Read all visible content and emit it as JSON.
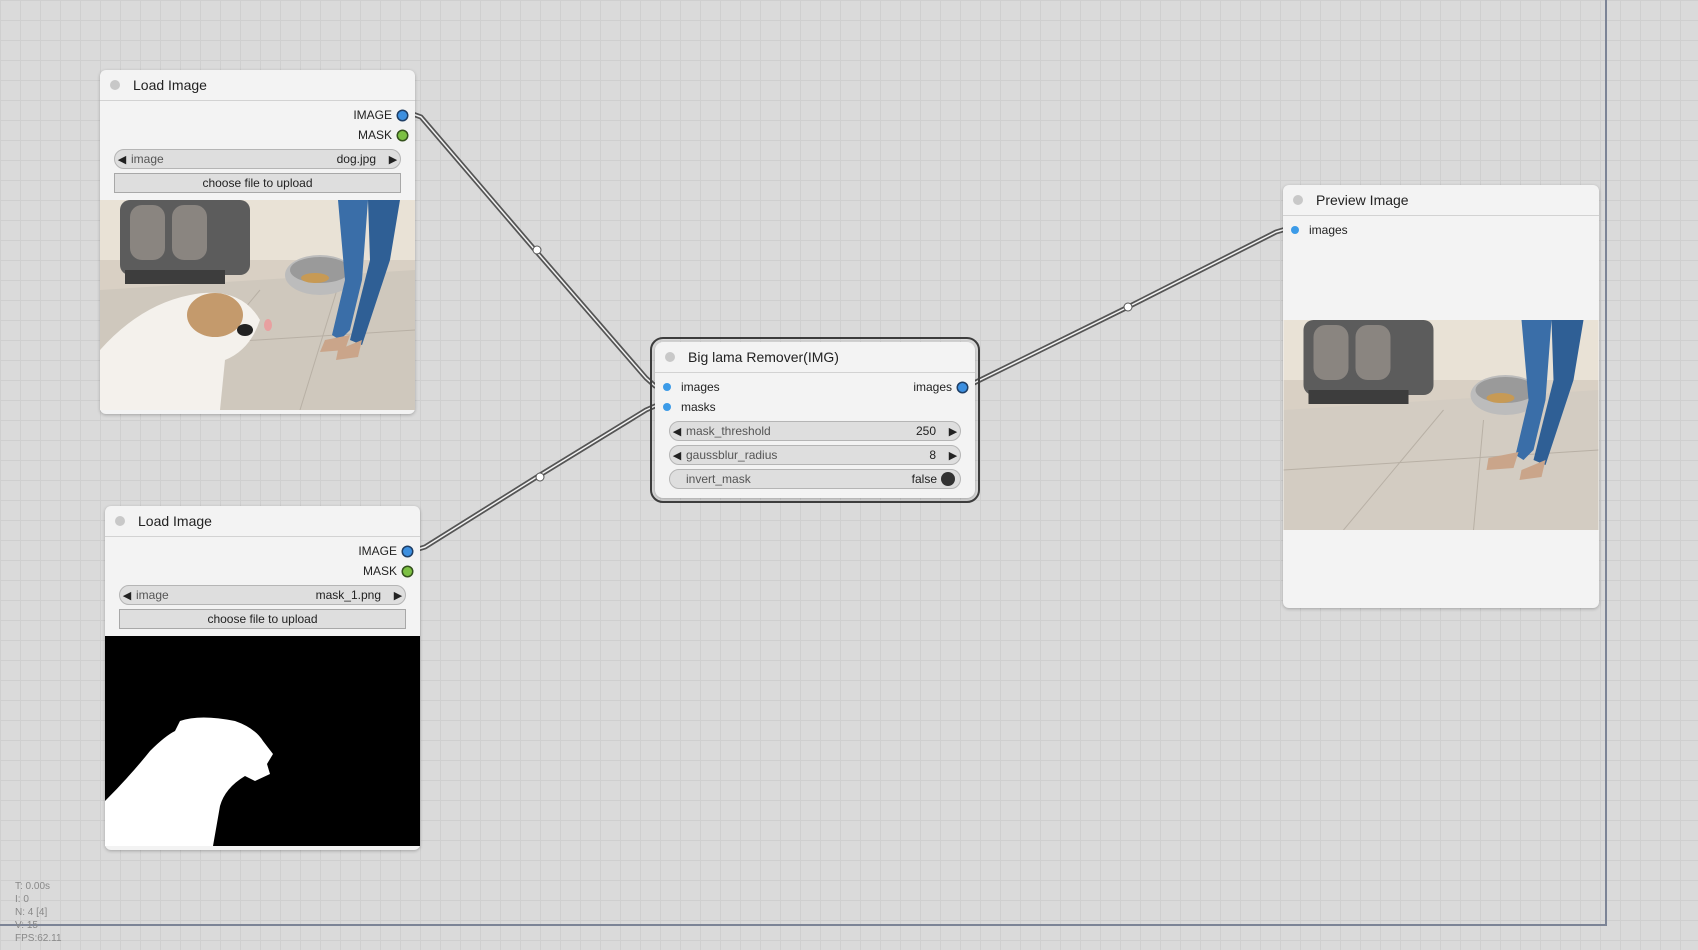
{
  "stats": {
    "time": "T: 0.00s",
    "iterations": "I: 0",
    "nodes": "N: 4 [4]",
    "vertices": "V: 15",
    "fps": "FPS:62.11"
  },
  "nodes": {
    "load_image_1": {
      "title": "Load Image",
      "outputs": [
        "IMAGE",
        "MASK"
      ],
      "image_widget": {
        "name": "image",
        "value": "dog.jpg"
      },
      "upload_label": "choose file to upload"
    },
    "load_image_2": {
      "title": "Load Image",
      "outputs": [
        "IMAGE",
        "MASK"
      ],
      "image_widget": {
        "name": "image",
        "value": "mask_1.png"
      },
      "upload_label": "choose file to upload"
    },
    "big_lama": {
      "title": "Big lama Remover(IMG)",
      "inputs": [
        "images",
        "masks"
      ],
      "outputs": [
        "images"
      ],
      "widgets": [
        {
          "name": "mask_threshold",
          "value": "250"
        },
        {
          "name": "gaussblur_radius",
          "value": "8"
        },
        {
          "name": "invert_mask",
          "value": "false"
        }
      ]
    },
    "preview_image": {
      "title": "Preview Image",
      "inputs": [
        "images"
      ]
    }
  },
  "colors": {
    "image_slot": "#3c8fe0",
    "mask_slot": "#7cc043",
    "link": "#555555",
    "canvas": "#dadada"
  }
}
